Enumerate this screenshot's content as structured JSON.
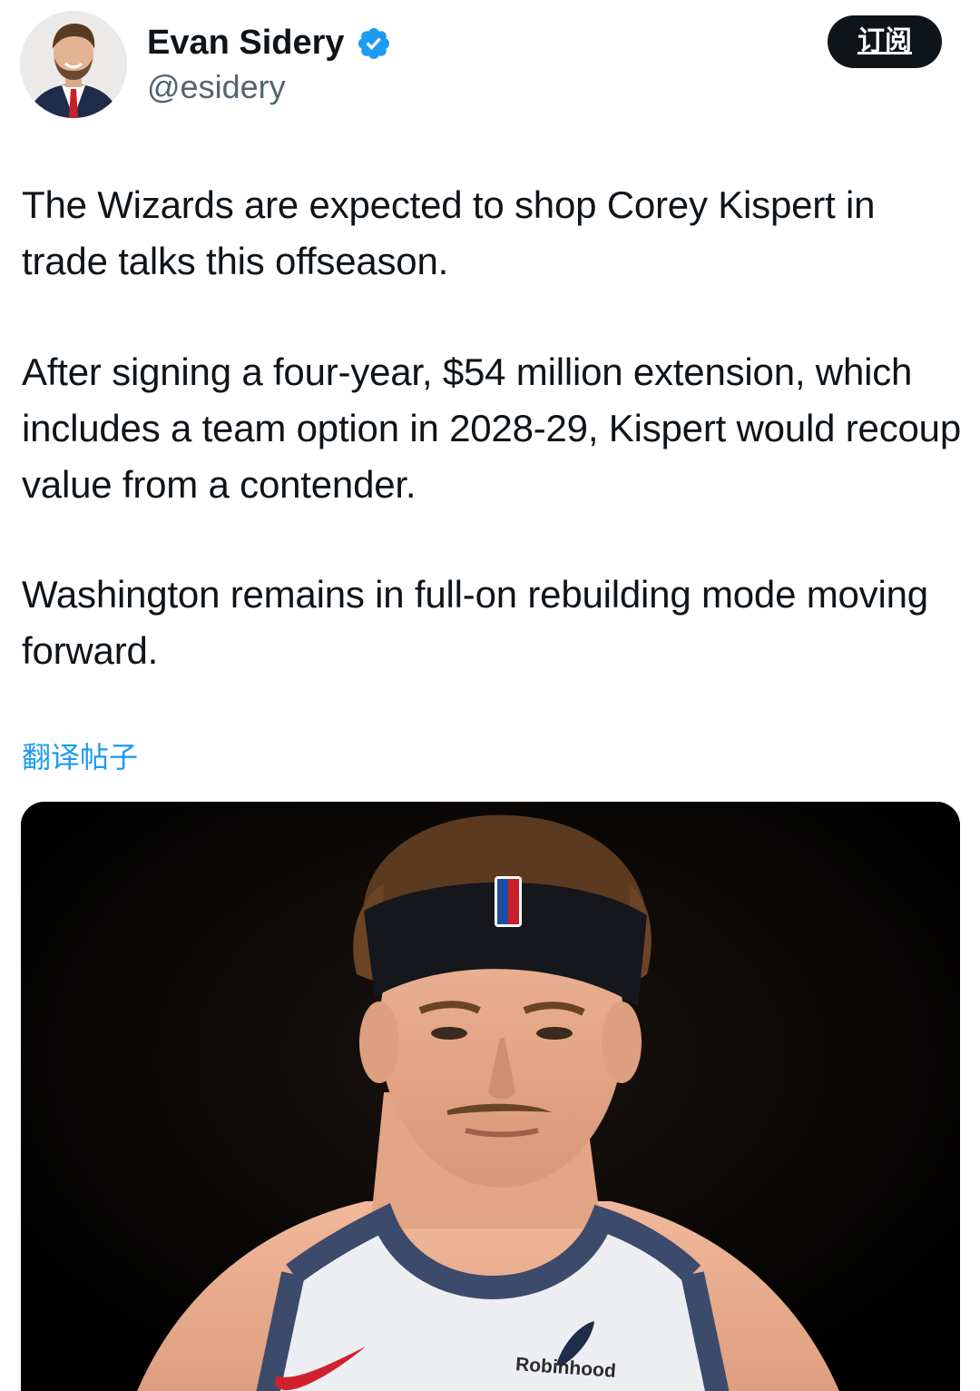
{
  "author": {
    "name": "Evan Sidery",
    "handle": "@esidery",
    "verified": true,
    "avatar_icon": "person-avatar"
  },
  "header": {
    "subscribe_label": "订阅"
  },
  "tweet": {
    "paragraphs": [
      "The Wizards are expected to shop Corey Kispert in trade talks this offseason.",
      "After signing a four-year, $54 million extension, which includes a team option in 2028-29, Kispert would recoup value from a contender.",
      "Washington remains in full-on rebuilding mode moving forward."
    ],
    "translate_label": "翻译帖子"
  },
  "media": {
    "description_icon": "player-photo",
    "sponsor_text": "Robinhood"
  },
  "colors": {
    "text": "#0f1419",
    "secondary": "#536471",
    "link": "#1d9bf0",
    "verified": "#1d9bf0",
    "button_bg": "#0f1419"
  }
}
